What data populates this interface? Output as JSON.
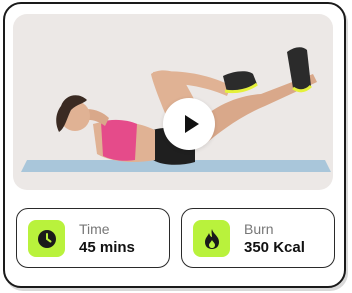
{
  "workout": {
    "media": {
      "image": "woman-doing-bicycle-crunch-on-mat",
      "play_icon": "play-icon"
    },
    "stats": [
      {
        "icon": "clock-icon",
        "label": "Time",
        "value": "45 mins"
      },
      {
        "icon": "flame-icon",
        "label": "Burn",
        "value": "350 Kcal"
      }
    ]
  },
  "colors": {
    "accent": "#b9f23c",
    "border": "#1a1a1a",
    "media_bg": "#ece8e6",
    "mat": "#a9c6da"
  }
}
